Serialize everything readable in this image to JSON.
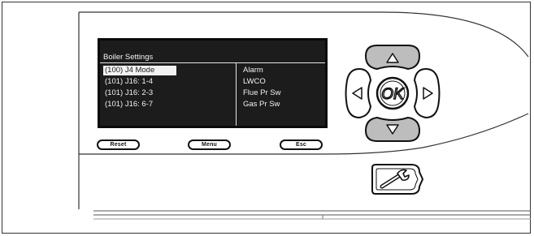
{
  "lcd": {
    "title": "Boiler Settings",
    "rows": [
      {
        "left": "(100) J4 Mode",
        "right": "Alarm",
        "selected": true
      },
      {
        "left": "(101) J16: 1-4",
        "right": "LWCO",
        "selected": false
      },
      {
        "left": "(101) J16: 2-3",
        "right": "Flue Pr Sw",
        "selected": false
      },
      {
        "left": "(101) J16: 6-7",
        "right": "Gas Pr Sw",
        "selected": false
      }
    ]
  },
  "buttons": {
    "reset_label": "Reset",
    "menu_label": "Menu",
    "esc_label": "Esc",
    "ok_label": "OK"
  },
  "icons": {
    "up": "up-arrow-icon",
    "down": "down-arrow-icon",
    "left": "left-arrow-icon",
    "right": "right-arrow-icon",
    "service": "wrench-icon"
  },
  "colors": {
    "lcd_background": "#1c1c1c",
    "lcd_text": "#f2f2f2",
    "button_grey": "#bdbdbd"
  }
}
